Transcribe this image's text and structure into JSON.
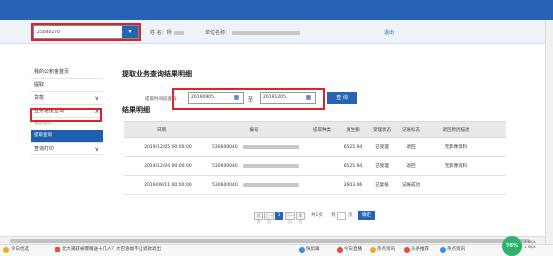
{
  "colors": {
    "brand": "#2763b5",
    "active": "#1f5fae",
    "highlight": "#d9262c"
  },
  "header": {
    "account_value": "25040270",
    "name_label": "姓 名：",
    "name_value": "杨",
    "unit_label": "单位名称：",
    "logout_label": "退出"
  },
  "sidebar": {
    "items": [
      {
        "label": "我的公积金首页"
      },
      {
        "label": "提取"
      },
      {
        "label": "贷款",
        "chevron": "∨"
      },
      {
        "label": "业务进度查询",
        "chevron": "∧"
      },
      {
        "label": "我的预约"
      },
      {
        "label": "提取查询"
      },
      {
        "label": "查询打印",
        "chevron": "∨"
      }
    ]
  },
  "main": {
    "title": "提取业务查询结果明细",
    "query_label": "提取时间段查询",
    "date_from": "20190905",
    "to_label": "至",
    "date_to": "20191205",
    "query_button": "查 询",
    "results_title": "结果明细"
  },
  "table": {
    "headers": [
      "日期",
      "编号",
      "提取种类",
      "发生额",
      "受理状态",
      "记账标志",
      "退回原因描述"
    ],
    "rows": [
      {
        "date": "2019/12/05 00:00:00",
        "id": "530600040",
        "kind": "",
        "amount": "6525.94",
        "status": "已受理",
        "flag": "退回",
        "reason": "无影像资料"
      },
      {
        "date": "2019/12/04 00:00:00",
        "id": "530600040",
        "kind": "",
        "amount": "6525.94",
        "status": "已受理",
        "flag": "退回",
        "reason": "无影像资料"
      },
      {
        "date": "2019/09/11 00:00:00",
        "id": "530600040",
        "kind": "",
        "amount": "2603.06",
        "status": "已复核",
        "flag": "记账成功",
        "reason": ""
      }
    ]
  },
  "pager": {
    "first": "首页",
    "prev": "上一页",
    "current": "1",
    "next": "下一页",
    "last": "尾页",
    "total": "共1页",
    "goto": "到",
    "page_unit": "页",
    "confirm": "确定"
  },
  "statusbar": {
    "left_label": "今日优选",
    "news": "北大捕获被曝赠送十几人？大巴涨幅不让退款退出",
    "items": [
      "快剪辑",
      "今日直播",
      "热点资讯",
      "头条推荐",
      "热点资讯"
    ],
    "gauge": "76%",
    "net_up": "0K/s",
    "net_down": "0K/s"
  }
}
